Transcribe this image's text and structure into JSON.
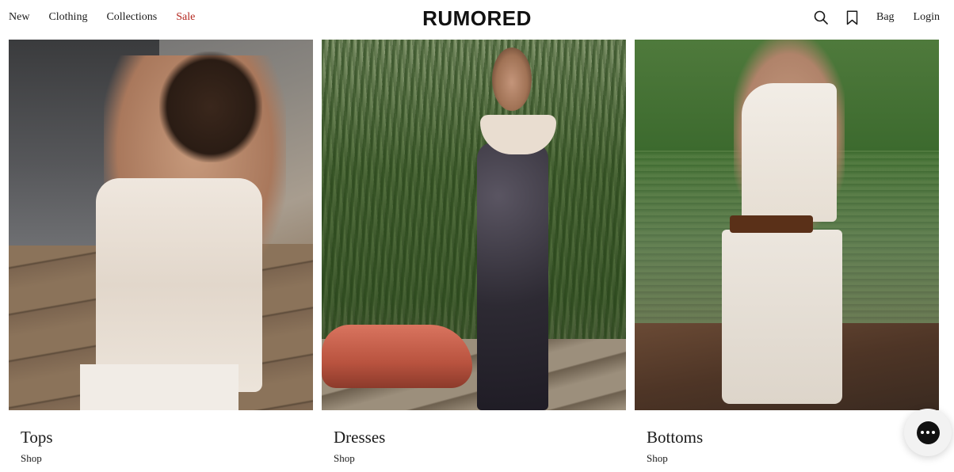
{
  "header": {
    "nav_left": [
      {
        "label": "New"
      },
      {
        "label": "Clothing"
      },
      {
        "label": "Collections"
      },
      {
        "label": "Sale"
      }
    ],
    "logo": "RUMORED",
    "icons": {
      "search": "search-icon",
      "wishlist": "bookmark-icon"
    },
    "bag_label": "Bag",
    "login_label": "Login"
  },
  "categories": [
    {
      "title": "Tops",
      "link": "Shop"
    },
    {
      "title": "Dresses",
      "link": "Shop"
    },
    {
      "title": "Bottoms",
      "link": "Shop"
    }
  ],
  "chat": {
    "icon": "chat-icon"
  },
  "colors": {
    "sale": "#b3261e",
    "text": "#1a1a1a",
    "background": "#ffffff"
  }
}
